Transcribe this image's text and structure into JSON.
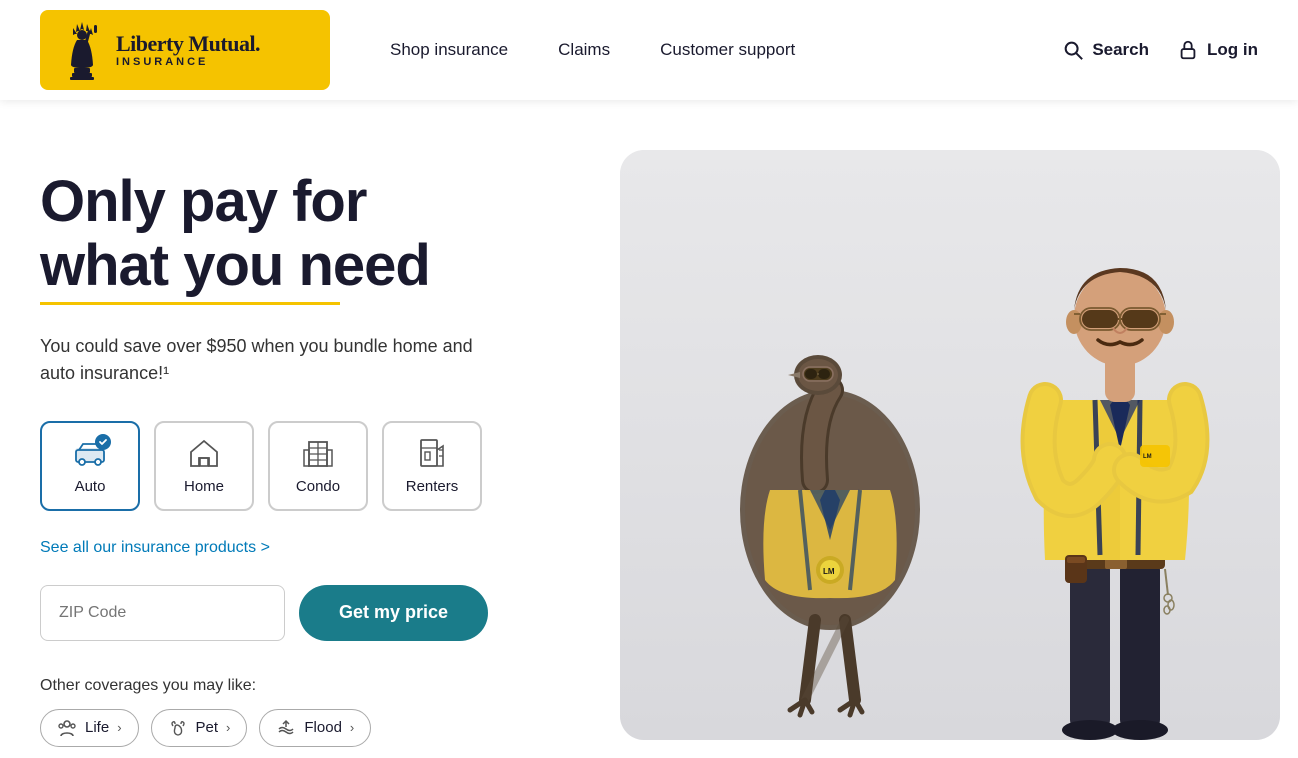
{
  "header": {
    "logo": {
      "brand_name": "Liberty Mutual.",
      "sub_text": "INSURANCE",
      "alt": "Liberty Mutual Insurance Logo"
    },
    "nav": [
      {
        "id": "shop-insurance",
        "label": "Shop insurance"
      },
      {
        "id": "claims",
        "label": "Claims"
      },
      {
        "id": "customer-support",
        "label": "Customer support"
      }
    ],
    "search_label": "Search",
    "login_label": "Log in"
  },
  "hero": {
    "headline_line1": "Only pay for",
    "headline_line2": "what you need",
    "subtext": "You could save over $950 when you bundle home and auto insurance!¹",
    "see_all_link": "See all our insurance products >",
    "zip_placeholder": "ZIP Code",
    "cta_label": "Get my price"
  },
  "insurance_tabs": [
    {
      "id": "auto",
      "label": "Auto",
      "active": true
    },
    {
      "id": "home",
      "label": "Home",
      "active": false
    },
    {
      "id": "condo",
      "label": "Condo",
      "active": false
    },
    {
      "id": "renters",
      "label": "Renters",
      "active": false
    }
  ],
  "other_coverages": {
    "label": "Other coverages you may like:",
    "chips": [
      {
        "id": "life",
        "label": "Life"
      },
      {
        "id": "pet",
        "label": "Pet"
      },
      {
        "id": "flood",
        "label": "Flood"
      }
    ]
  },
  "colors": {
    "yellow": "#f5c300",
    "teal": "#1a7c8a",
    "navy": "#1a1a2e",
    "blue": "#1a6ea8",
    "link_blue": "#007ab8"
  }
}
